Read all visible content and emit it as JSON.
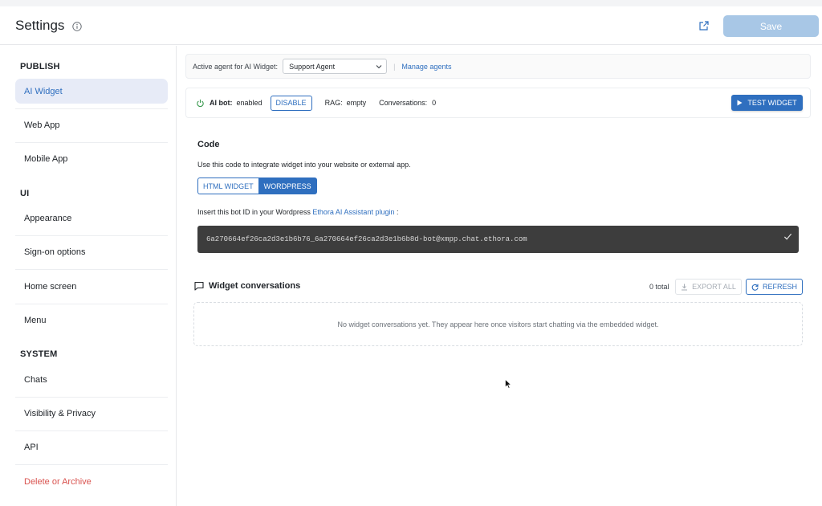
{
  "header": {
    "title": "Settings",
    "save_label": "Save"
  },
  "sidebar": {
    "sections": [
      {
        "title": "PUBLISH",
        "items": [
          "AI Widget",
          "Web App",
          "Mobile App"
        ]
      },
      {
        "title": "UI",
        "items": [
          "Appearance",
          "Sign-on options",
          "Home screen",
          "Menu"
        ]
      },
      {
        "title": "SYSTEM",
        "items": [
          "Chats",
          "Visibility & Privacy",
          "API",
          "Delete or Archive"
        ]
      }
    ],
    "active_item": "AI Widget"
  },
  "agent_bar": {
    "label": "Active agent for AI Widget:",
    "selected_agent": "Support Agent",
    "separator": "|",
    "manage_link": "Manage agents"
  },
  "status_bar": {
    "ai_bot_label": "AI bot:",
    "ai_bot_value": "enabled",
    "disable_label": "DISABLE",
    "rag_label": "RAG:",
    "rag_value": "empty",
    "conversations_label": "Conversations:",
    "conversations_value": "0",
    "test_widget_label": "TEST WIDGET"
  },
  "code_section": {
    "title": "Code",
    "description": "Use this code to integrate widget into your website or external app.",
    "tabs": [
      "HTML WIDGET",
      "WORDPRESS"
    ],
    "selected_tab": "WORDPRESS",
    "insert_prefix": "Insert this bot ID in your Wordpress",
    "insert_link": "Ethora AI Assistant plugin",
    "insert_suffix": ":",
    "bot_id": "6a270664ef26ca2d3e1b6b76_6a270664ef26ca2d3e1b6b8d-bot@xmpp.chat.ethora.com"
  },
  "widget_conversations": {
    "title": "Widget conversations",
    "total": "0 total",
    "export_label": "EXPORT ALL",
    "refresh_label": "REFRESH",
    "empty_message": "No widget conversations yet. They appear here once visitors start chatting via the embedded widget."
  },
  "colors": {
    "accent": "#2f6fbf",
    "save_disabled": "#a8c7e6",
    "danger": "#d9534f",
    "code_bg": "#3d3d3d",
    "active_nav_bg": "#e7ebf7",
    "power_green": "#3a9a4f"
  },
  "icons": [
    "info-icon",
    "external-link-icon",
    "power-icon",
    "play-icon",
    "check-icon",
    "chat-icon",
    "download-icon",
    "refresh-icon",
    "chevron-down-icon",
    "mouse-cursor"
  ]
}
